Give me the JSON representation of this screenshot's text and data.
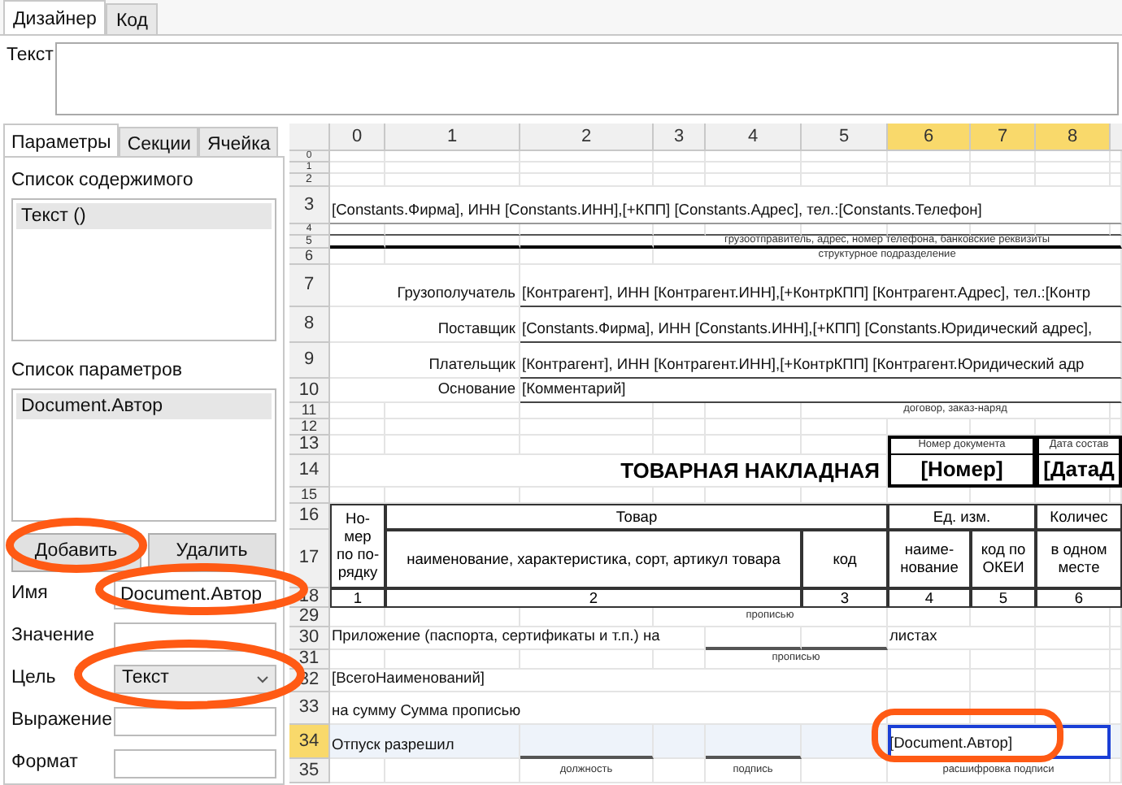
{
  "designer_tabs": [
    {
      "label": "Дизайнер",
      "selected": true
    },
    {
      "label": "Код",
      "selected": false
    }
  ],
  "text_field": {
    "label": "Текст"
  },
  "panel_tabs": [
    {
      "label": "Параметры",
      "selected": true
    },
    {
      "label": "Секции",
      "selected": false
    },
    {
      "label": "Ячейка",
      "selected": false
    }
  ],
  "content_list": {
    "title": "Список содержимого",
    "items": [
      {
        "label": "Текст ()",
        "selected": true
      }
    ]
  },
  "parameter_list": {
    "title": "Список параметров",
    "items": [
      {
        "label": "Document.Автор",
        "selected": true
      }
    ]
  },
  "buttons": [
    "Добавить",
    "Удалить"
  ],
  "fields": [
    {
      "label": "Имя",
      "kind": "input",
      "value": "Document.Автор"
    },
    {
      "label": "Значение",
      "kind": "input"
    },
    {
      "label": "Цель",
      "kind": "select",
      "value": "Текст"
    },
    {
      "label": "Выражение",
      "kind": "input"
    },
    {
      "label": "Формат",
      "kind": "input"
    }
  ],
  "sheet": {
    "columns": [
      {
        "label": "0",
        "selected": false
      },
      {
        "label": "1",
        "selected": false
      },
      {
        "label": "2",
        "selected": false
      },
      {
        "label": "3",
        "selected": false
      },
      {
        "label": "4",
        "selected": false
      },
      {
        "label": "5",
        "selected": false
      },
      {
        "label": "6",
        "selected": true
      },
      {
        "label": "7",
        "selected": true
      },
      {
        "label": "8",
        "selected": true
      }
    ],
    "rows": [
      {
        "label": "0",
        "selected": false
      },
      {
        "label": "1",
        "selected": false
      },
      {
        "label": "2",
        "selected": false
      },
      {
        "label": "3",
        "selected": false,
        "cells": [
          {
            "kind": "text",
            "text": "[Constants.Фирма], ИНН [Constants.ИНН],[+КПП] [Constants.Адрес], тел.:[Constants.Телефон]",
            "selected": false
          }
        ]
      },
      {
        "label": "4",
        "selected": false
      },
      {
        "label": "5",
        "selected": false,
        "cells": [
          {
            "kind": "caption",
            "text": "грузоотправитель, адрес, номер телефона, банковские реквизиты",
            "selected": false
          }
        ]
      },
      {
        "label": "6",
        "selected": false,
        "cells": [
          {
            "kind": "caption",
            "text": "структурное подразделение",
            "selected": false
          }
        ]
      },
      {
        "label": "7",
        "selected": false,
        "cells": [
          {
            "kind": "label",
            "text": "Грузополучатель",
            "selected": false
          },
          {
            "kind": "text",
            "text": "[Контрагент], ИНН [Контрагент.ИНН],[+КонтрКПП] [Контрагент.Адрес], тел.:[Контр",
            "selected": false
          }
        ]
      },
      {
        "label": "8",
        "selected": false,
        "cells": [
          {
            "kind": "label",
            "text": "Поставщик",
            "selected": false
          },
          {
            "kind": "text",
            "text": "[Constants.Фирма], ИНН [Constants.ИНН],[+КПП] [Constants.Юридический адрес],",
            "selected": false
          }
        ]
      },
      {
        "label": "9",
        "selected": false,
        "cells": [
          {
            "kind": "label",
            "text": "Плательщик",
            "selected": false
          },
          {
            "kind": "text",
            "text": "[Контрагент], ИНН [Контрагент.ИНН],[+КонтрКПП] [Контрагент.Юридический адр",
            "selected": false
          }
        ]
      },
      {
        "label": "10",
        "selected": false,
        "cells": [
          {
            "kind": "label",
            "text": "Основание",
            "selected": false
          },
          {
            "kind": "text",
            "text": "[Комментарий]",
            "selected": false
          }
        ]
      },
      {
        "label": "11",
        "selected": false,
        "cells": [
          {
            "kind": "caption",
            "text": "договор, заказ-наряд",
            "selected": false
          }
        ]
      },
      {
        "label": "12",
        "selected": false
      },
      {
        "label": "13",
        "selected": false,
        "cells": [
          {
            "kind": "boxed-caption",
            "text": "Номер документа",
            "selected": false
          },
          {
            "kind": "boxed-caption",
            "text": "Дата состав",
            "selected": false
          }
        ]
      },
      {
        "label": "14",
        "selected": false,
        "cells": [
          {
            "kind": "title",
            "text": "ТОВАРНАЯ НАКЛАДНАЯ",
            "selected": false
          },
          {
            "kind": "doc-field",
            "text": "[Номер]",
            "selected": false
          },
          {
            "kind": "doc-field",
            "text": "[ДатаД",
            "selected": false
          }
        ]
      },
      {
        "label": "15",
        "selected": false
      },
      {
        "label": "16",
        "selected": false,
        "cells": [
          {
            "kind": "header",
            "text": "Но-\nмер\nпо по-\nрядку",
            "selected": false
          },
          {
            "kind": "header",
            "text": "Товар",
            "selected": false
          },
          {
            "kind": "header",
            "text": "Ед. изм.",
            "selected": false
          },
          {
            "kind": "header",
            "text": "Количес",
            "selected": false
          }
        ]
      },
      {
        "label": "17",
        "selected": false,
        "cells": [
          {
            "kind": "header",
            "text": "наименование, характеристика, сорт, артикул товара",
            "selected": false
          },
          {
            "kind": "header",
            "text": "код",
            "selected": false
          },
          {
            "kind": "header",
            "text": "наиме-\nнование",
            "selected": false
          },
          {
            "kind": "header",
            "text": "код по\nОКЕИ",
            "selected": false
          },
          {
            "kind": "header",
            "text": "в одном\nместе",
            "selected": false
          }
        ]
      },
      {
        "label": "18",
        "selected": false,
        "cells": [
          {
            "kind": "header",
            "text": "1",
            "selected": false
          },
          {
            "kind": "header",
            "text": "2",
            "selected": false
          },
          {
            "kind": "header",
            "text": "3",
            "selected": false
          },
          {
            "kind": "header",
            "text": "4",
            "selected": false
          },
          {
            "kind": "header",
            "text": "5",
            "selected": false
          },
          {
            "kind": "header",
            "text": "6",
            "selected": false
          }
        ]
      },
      {
        "label": "29",
        "selected": false,
        "cells": [
          {
            "kind": "caption",
            "text": "прописью",
            "selected": false
          }
        ]
      },
      {
        "label": "30",
        "selected": false,
        "cells": [
          {
            "kind": "text",
            "text": "Приложение (паспорта, сертификаты и т.п.) на",
            "selected": false
          },
          {
            "kind": "text",
            "text": "листах",
            "selected": false
          }
        ]
      },
      {
        "label": "31",
        "selected": false,
        "cells": [
          {
            "kind": "caption",
            "text": "прописью",
            "selected": false
          }
        ]
      },
      {
        "label": "32",
        "selected": false,
        "cells": [
          {
            "kind": "text",
            "text": "[ВсегоНаименований]",
            "selected": false
          }
        ]
      },
      {
        "label": "33",
        "selected": false,
        "cells": [
          {
            "kind": "text",
            "text": "на сумму Сумма прописью",
            "selected": false
          }
        ]
      },
      {
        "label": "34",
        "selected": true,
        "cells": [
          {
            "kind": "text",
            "text": "Отпуск разрешил",
            "selected": false
          },
          {
            "kind": "text",
            "text": "[Document.Автор]",
            "selected": true
          }
        ]
      },
      {
        "label": "35",
        "selected": false,
        "cells": [
          {
            "kind": "caption",
            "text": "должность",
            "selected": false
          },
          {
            "kind": "caption",
            "text": "подпись",
            "selected": false
          },
          {
            "kind": "caption",
            "text": "расшифровка подписи",
            "selected": false
          }
        ]
      }
    ]
  }
}
